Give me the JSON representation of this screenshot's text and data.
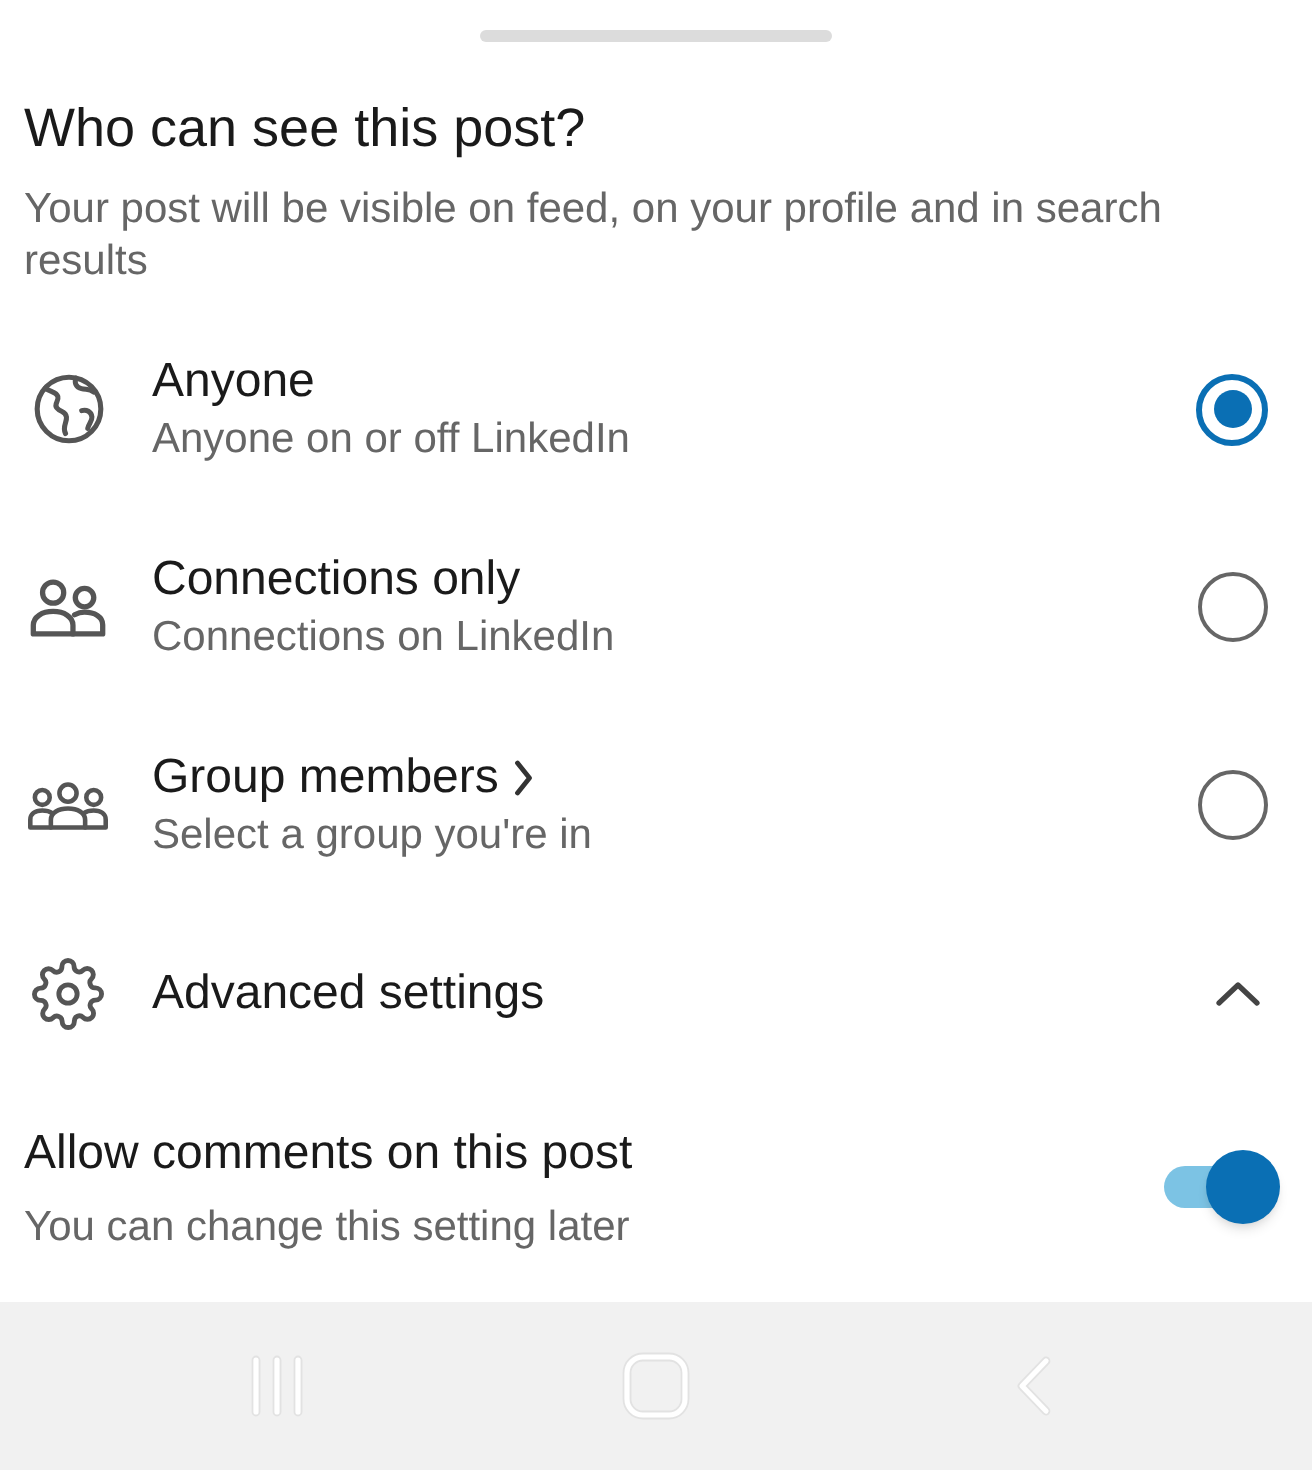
{
  "sheet": {
    "title": "Who can see this post?",
    "subtitle": "Your post will be visible on feed, on your profile and in search results"
  },
  "options": [
    {
      "kind": "public",
      "label": "Anyone",
      "description": "Anyone on or off LinkedIn",
      "has_submenu": false,
      "selected": true
    },
    {
      "kind": "connections",
      "label": "Connections only",
      "description": "Connections on LinkedIn",
      "has_submenu": false,
      "selected": false
    },
    {
      "kind": "group",
      "label": "Group members",
      "description": "Select a group you're in",
      "has_submenu": true,
      "selected": false
    }
  ],
  "advanced": {
    "label": "Advanced settings",
    "expanded": true
  },
  "comments": {
    "label": "Allow comments on this post",
    "description": "You can change this setting later",
    "on": true
  }
}
